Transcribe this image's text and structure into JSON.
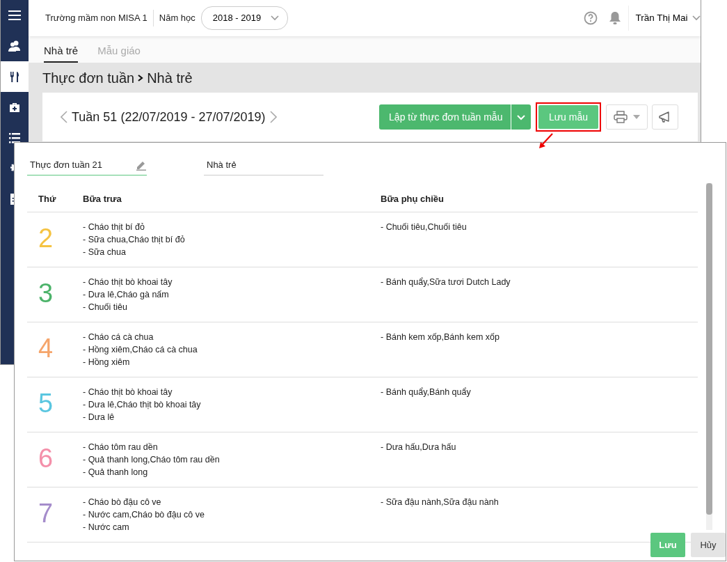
{
  "header": {
    "school": "Trường mầm non MISA 1",
    "year_label": "Năm học",
    "year_value": "2018 - 2019",
    "user": "Trần Thị Mai"
  },
  "sidebar": {
    "items": [
      {
        "kind": "users",
        "selected": false
      },
      {
        "kind": "food",
        "selected": true
      },
      {
        "kind": "medkit",
        "selected": false
      },
      {
        "kind": "list",
        "selected": false
      },
      {
        "kind": "gear",
        "selected": false
      },
      {
        "kind": "document",
        "selected": false
      }
    ]
  },
  "tabs": [
    {
      "label": "Nhà trẻ",
      "selected": true
    },
    {
      "label": "Mẫu giáo",
      "selected": false
    }
  ],
  "breadcrumb": [
    "Thực đơn tuần",
    "Nhà trẻ"
  ],
  "week": {
    "label": "Tuần 51 (22/07/2019 - 27/07/2019)"
  },
  "toolbar": {
    "template_button": "Lập từ thực đơn tuần mẫu",
    "save_template_button": "Lưu mẫu",
    "highlighted": true
  },
  "dialog": {
    "name_value": "Thực đơn tuần 21",
    "group_value": "Nhà trẻ",
    "columns": [
      "Thứ",
      "Bữa trưa",
      "Bữa phụ chiều"
    ],
    "rows": [
      {
        "day": "2",
        "color": "#f5c342",
        "lunch": [
          "- Cháo thịt bí đỏ",
          "- Sữa chua,Cháo thịt bí đỏ",
          "- Sữa chua"
        ],
        "snack": [
          "- Chuối tiêu,Chuối tiêu"
        ]
      },
      {
        "day": "3",
        "color": "#4cb36a",
        "lunch": [
          "- Cháo thịt bò khoai tây",
          "- Dưa lê,Cháo gà nấm",
          "- Chuối tiêu"
        ],
        "snack": [
          "- Bánh quẩy,Sữa tươi Dutch Lady"
        ]
      },
      {
        "day": "4",
        "color": "#f5a56b",
        "lunch": [
          "- Cháo cá cà chua",
          "- Hồng xiêm,Cháo cá cà chua",
          "- Hồng xiêm"
        ],
        "snack": [
          "- Bánh kem xốp,Bánh kem xốp"
        ]
      },
      {
        "day": "5",
        "color": "#5ac6e0",
        "lunch": [
          "- Cháo thịt bò khoai tây",
          "- Dưa lê,Cháo thịt bò khoai tây",
          "- Dưa lê"
        ],
        "snack": [
          "- Bánh quẩy,Bánh quẩy"
        ]
      },
      {
        "day": "6",
        "color": "#f490aa",
        "lunch": [
          "- Cháo tôm rau dền",
          "- Quả thanh long,Cháo tôm rau dền",
          "- Quả thanh long"
        ],
        "snack": [
          "- Dưa hấu,Dưa hấu"
        ]
      },
      {
        "day": "7",
        "color": "#a58ccb",
        "lunch": [
          "- Cháo bò đậu cô ve",
          "- Nước cam,Cháo bò đậu cô ve",
          "- Nước cam"
        ],
        "snack": [
          "- Sữa đậu nành,Sữa đậu nành"
        ]
      }
    ],
    "buttons": [
      {
        "label": "Lưu",
        "kind": "primary"
      },
      {
        "label": "Hủy",
        "kind": "secondary"
      }
    ]
  }
}
